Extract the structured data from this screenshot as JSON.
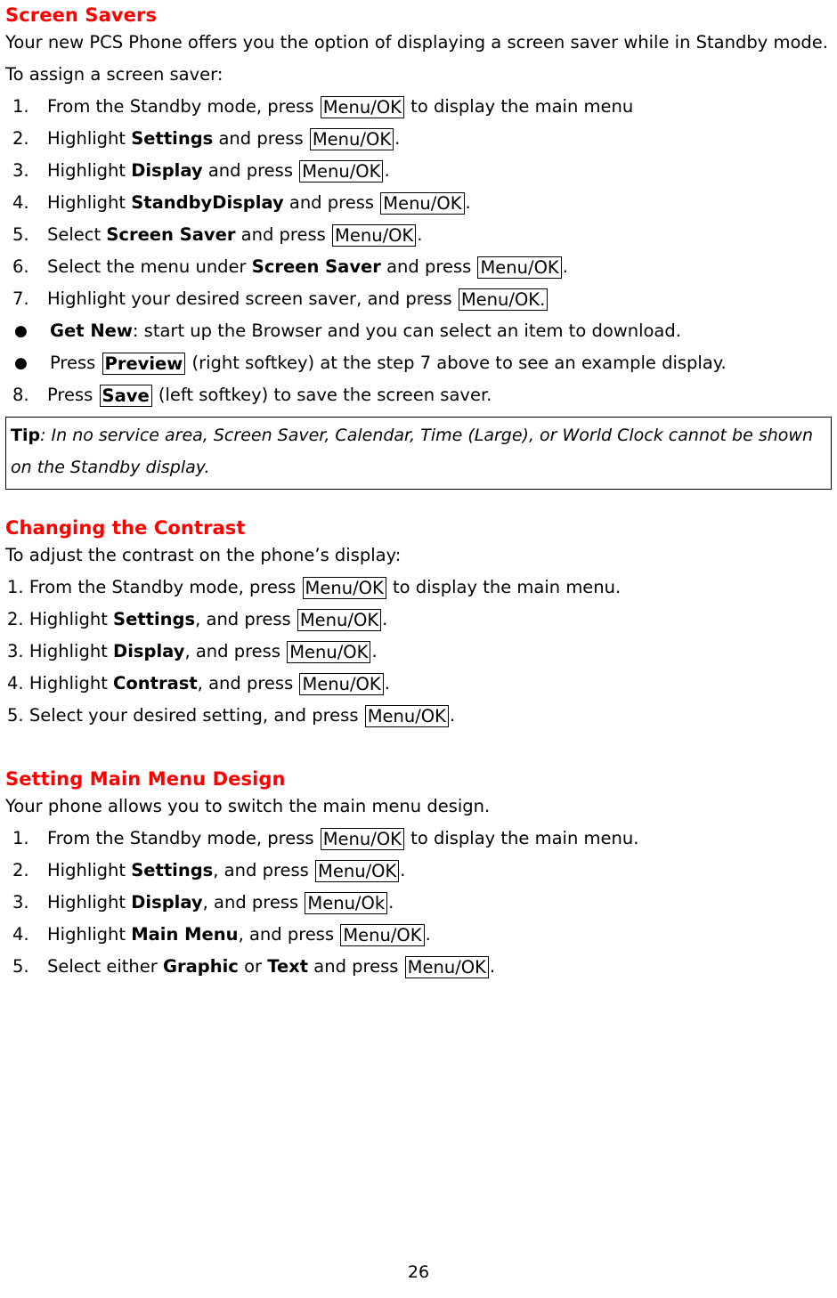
{
  "document": {
    "page_number": "26",
    "heading_color": "#ff0000"
  },
  "section1": {
    "heading": "Screen Savers",
    "intro": "Your new PCS Phone offers you the option of displaying a screen saver while in Standby mode.",
    "lead_in": "To assign a screen saver:",
    "steps": [
      {
        "marker": "1.",
        "pre": "From the Standby mode, press ",
        "key": "Menu/OK",
        "post": " to display the main menu"
      },
      {
        "marker": "2.",
        "pre": "Highlight ",
        "bold": "Settings",
        "mid": " and press ",
        "key": "Menu/OK",
        "post": "."
      },
      {
        "marker": "3.",
        "pre": "Highlight ",
        "bold": "Display",
        "mid": " and press ",
        "key": "Menu/OK",
        "post": "."
      },
      {
        "marker": "4.",
        "pre": "Highlight ",
        "bold": "StandbyDisplay",
        "mid": " and press ",
        "key": "Menu/OK",
        "post": "."
      },
      {
        "marker": "5.",
        "pre": "Select ",
        "bold": "Screen Saver",
        "mid": " and press ",
        "key": "Menu/OK",
        "post": "."
      },
      {
        "marker": "6.",
        "pre": "Select the menu under ",
        "bold": "Screen Saver",
        "mid": " and press ",
        "key": "Menu/OK",
        "post": "."
      },
      {
        "marker": "7.",
        "pre": "Highlight your desired screen saver, and press ",
        "key": "Menu/OK.",
        "post": ""
      }
    ],
    "bullets": [
      {
        "marker": "●",
        "bold": " Get New",
        "text": ": start up the Browser and you can select an item to download."
      },
      {
        "marker": "●",
        "pre": " Press ",
        "key": "Preview",
        "post": " (right softkey) at the step 7 above to see an example display."
      }
    ],
    "last_step": {
      "marker": "8.",
      "pre": "Press ",
      "key": "Save",
      "post": " (left softkey) to save the screen saver."
    },
    "tip": {
      "label": "Tip",
      "text": ": In no service area, Screen Saver, Calendar, Time (Large), or World Clock cannot be shown on the Standby display."
    }
  },
  "section2": {
    "heading": "Changing the Contrast",
    "lead_in": "To adjust the contrast on the phone’s display:",
    "steps": [
      {
        "marker": "1. ",
        "pre": "From the Standby mode, press ",
        "key": "Menu/OK",
        "post": " to display the main menu."
      },
      {
        "marker": "2. ",
        "pre": "Highlight ",
        "bold": "Settings",
        "mid": ", and press ",
        "key": "Menu/OK",
        "post": "."
      },
      {
        "marker": "3. ",
        "pre": "Highlight ",
        "bold": "Display",
        "mid": ", and press ",
        "key": "Menu/OK",
        "post": "."
      },
      {
        "marker": "4. ",
        "pre": "Highlight ",
        "bold": "Contrast",
        "mid": ", and press ",
        "key": "Menu/OK",
        "post": "."
      },
      {
        "marker": "5. ",
        "pre": "Select your desired setting, and press ",
        "key": "Menu/OK",
        "post": "."
      }
    ]
  },
  "section3": {
    "heading": "Setting Main Menu Design",
    "lead_in": "Your phone allows you to switch the main menu design.",
    "steps": [
      {
        "marker": "1.",
        "pre": "From the Standby mode, press ",
        "key": "Menu/OK",
        "post": " to display the main menu."
      },
      {
        "marker": "2.",
        "pre": "Highlight ",
        "bold": "Settings",
        "mid": ", and press ",
        "key": "Menu/OK",
        "post": "."
      },
      {
        "marker": "3.",
        "pre": "Highlight ",
        "bold": "Display",
        "mid": ", and press ",
        "key": "Menu/Ok",
        "post": "."
      },
      {
        "marker": "4.",
        "pre": "Highlight ",
        "bold": "Main Menu",
        "mid": ", and press ",
        "key": "Menu/OK",
        "post": "."
      },
      {
        "marker": "5.",
        "pre": "Select either ",
        "bold": "Graphic",
        "mid2": " or ",
        "bold2": "Text",
        "mid": " and press ",
        "key": "Menu/OK",
        "post": "."
      }
    ]
  }
}
